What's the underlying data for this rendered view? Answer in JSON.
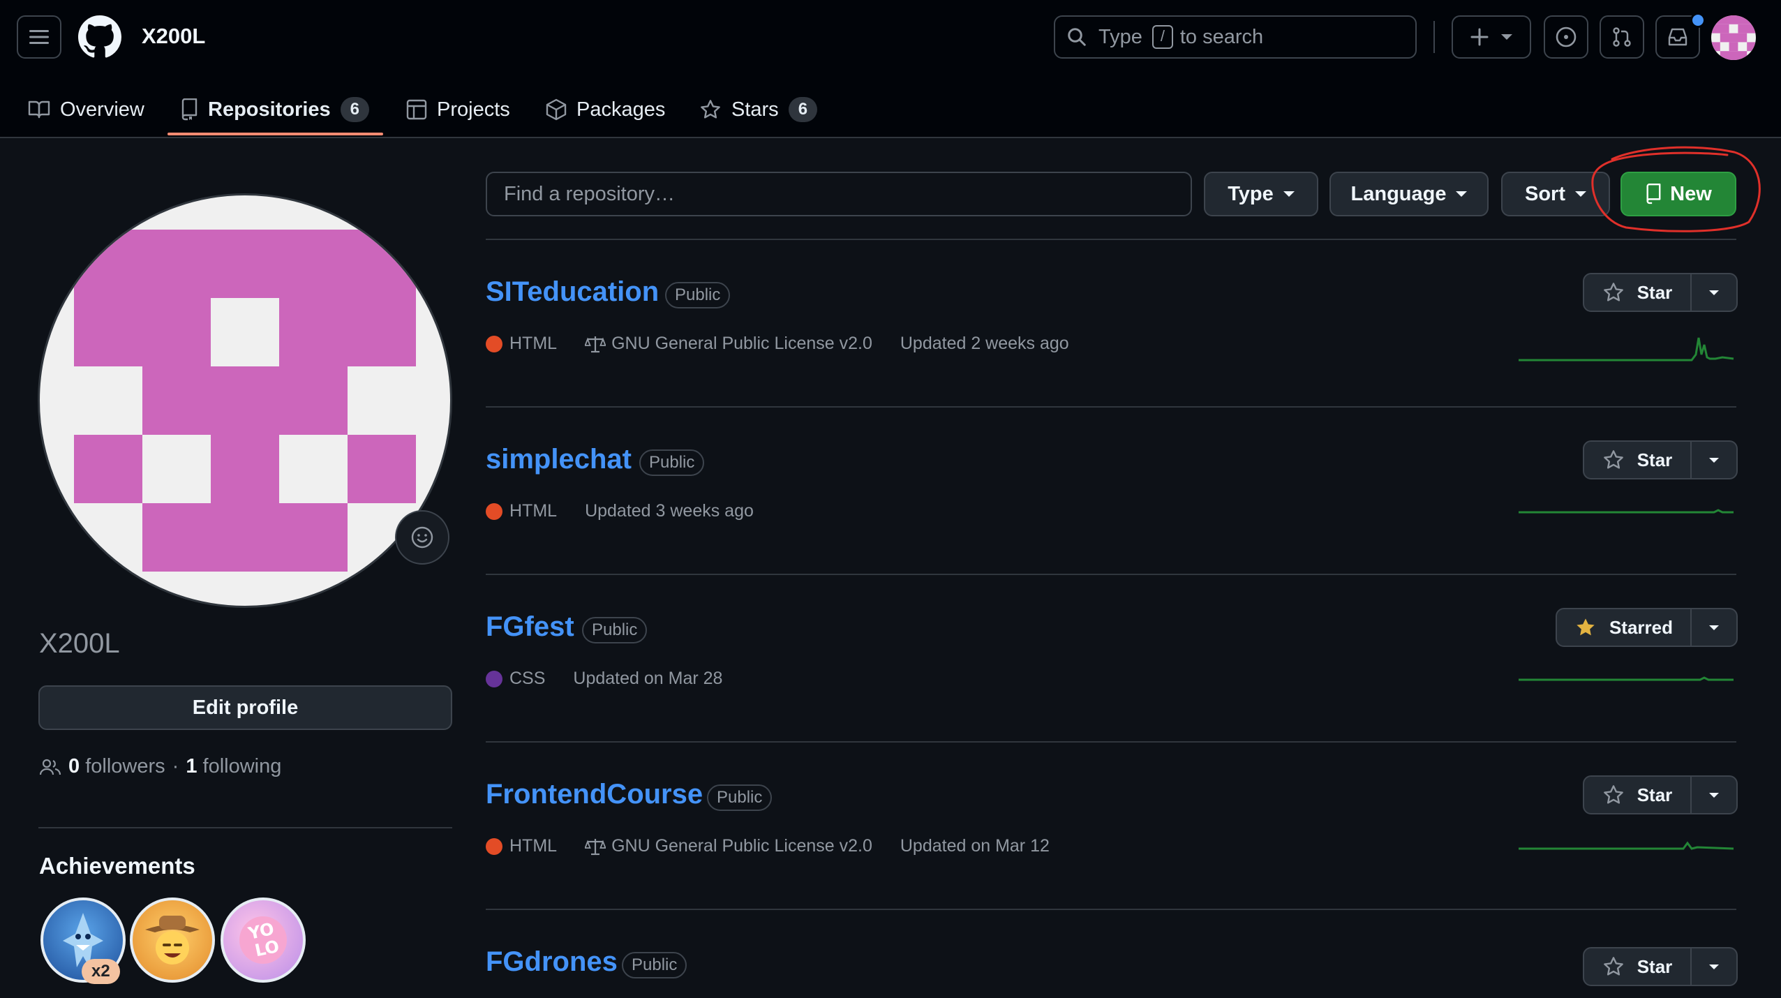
{
  "header": {
    "owner": "X200L",
    "search": {
      "prefix": "Type",
      "key": "/",
      "suffix": "to search"
    },
    "icons": [
      "hamburger-icon",
      "github-logo",
      "search-icon",
      "plus-icon",
      "issues-icon",
      "pull-requests-icon",
      "inbox-icon"
    ]
  },
  "tabs": [
    {
      "label": "Overview",
      "icon": "book-icon"
    },
    {
      "label": "Repositories",
      "count": "6",
      "icon": "repo-icon",
      "active": true
    },
    {
      "label": "Projects",
      "icon": "table-icon"
    },
    {
      "label": "Packages",
      "icon": "package-icon"
    },
    {
      "label": "Stars",
      "count": "6",
      "icon": "star-icon"
    }
  ],
  "profile": {
    "login": "X200L",
    "edit_label": "Edit profile",
    "followers_count": "0",
    "followers_label": "followers",
    "separator": "·",
    "following_count": "1",
    "following_label": "following",
    "achievements_title": "Achievements",
    "achievement_multiplier": "x2",
    "avatar_color": "#cc66bb"
  },
  "filters": {
    "placeholder": "Find a repository…",
    "type_label": "Type",
    "language_label": "Language",
    "sort_label": "Sort",
    "new_label": "New"
  },
  "repos": [
    {
      "name": "SITeducation",
      "visibility": "Public",
      "language": "HTML",
      "lang_color": "#e34c26",
      "license": "GNU General Public License v2.0",
      "updated": "Updated 2 weeks ago",
      "star_label": "Star"
    },
    {
      "name": "simplechat",
      "visibility": "Public",
      "language": "HTML",
      "lang_color": "#e34c26",
      "updated": "Updated 3 weeks ago",
      "star_label": "Star"
    },
    {
      "name": "FGfest",
      "visibility": "Public",
      "language": "CSS",
      "lang_color": "#663399",
      "updated": "Updated on Mar 28",
      "star_label": "Starred"
    },
    {
      "name": "FrontendCourse",
      "visibility": "Public",
      "language": "HTML",
      "lang_color": "#e34c26",
      "license": "GNU General Public License v2.0",
      "updated": "Updated on Mar 12",
      "star_label": "Star"
    },
    {
      "name": "FGdrones",
      "visibility": "Public",
      "star_label": "Star"
    }
  ],
  "colors": {
    "accent_link": "#4493f8",
    "new_button": "#238636",
    "tab_underline": "#fd8c73",
    "annotation": "#e0302a"
  }
}
